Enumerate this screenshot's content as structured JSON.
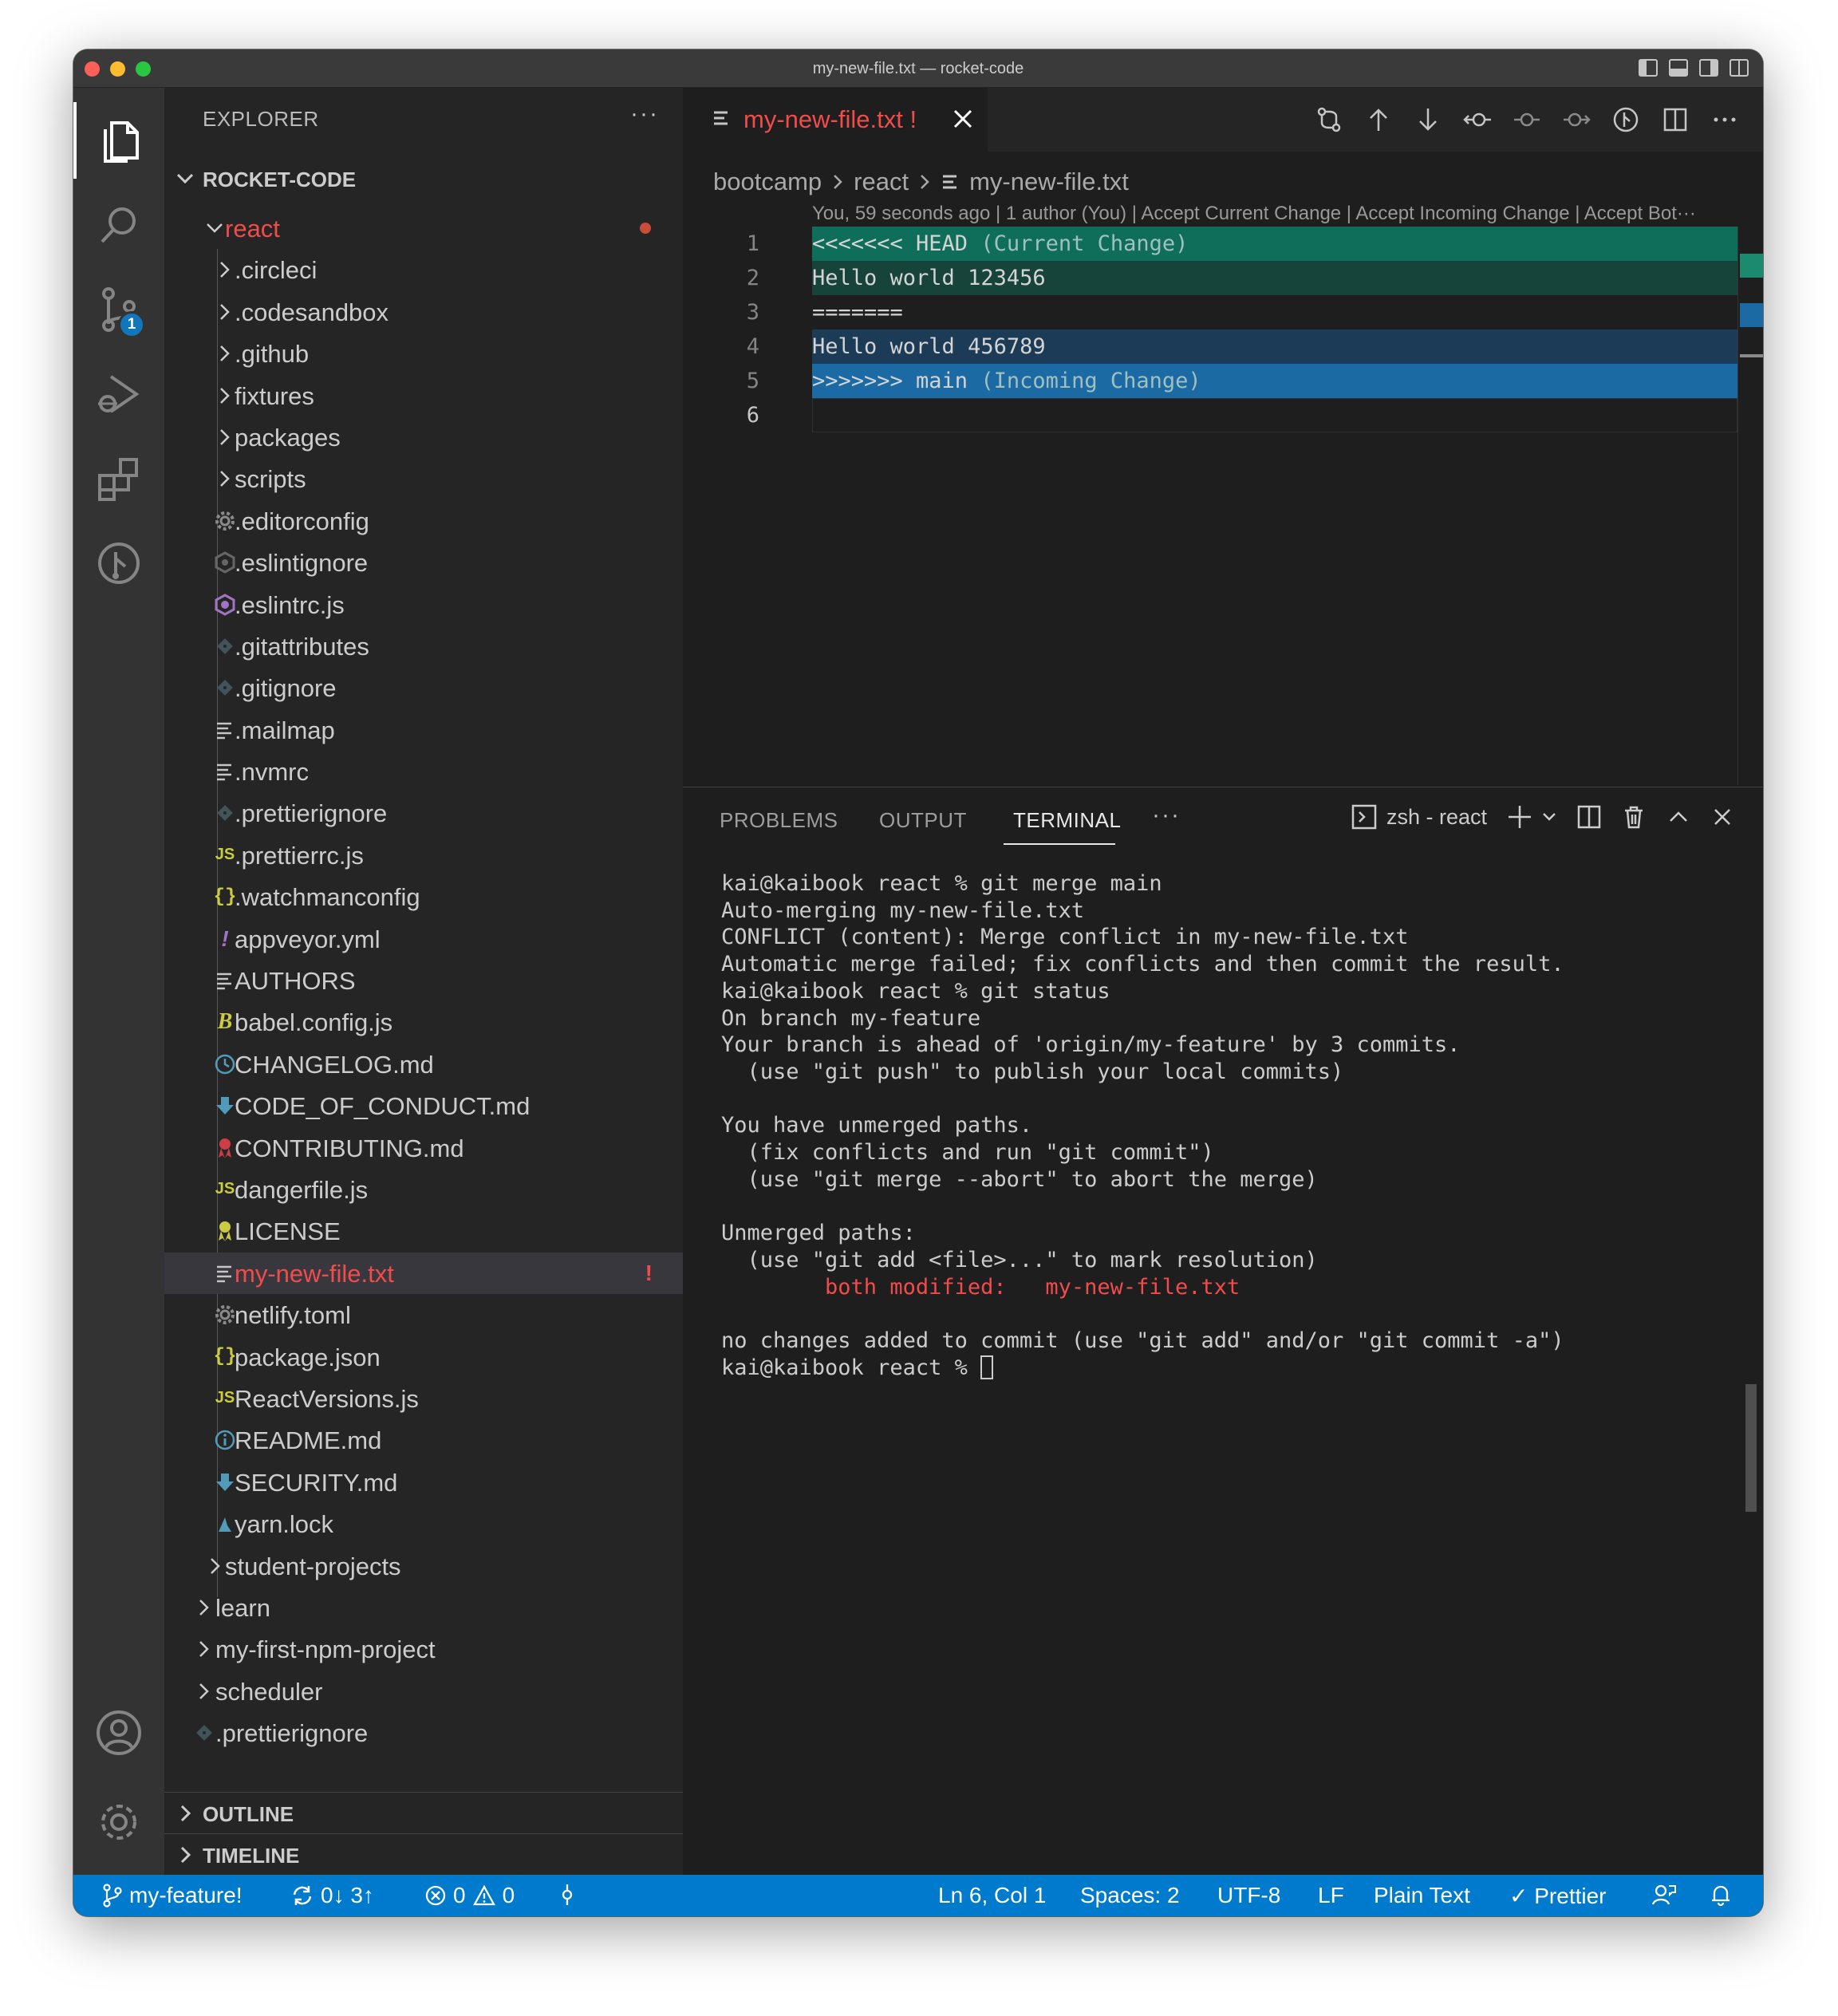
{
  "window": {
    "title": "my-new-file.txt — rocket-code"
  },
  "activity": {
    "scm_badge": "1"
  },
  "explorer": {
    "header": "EXPLORER",
    "more": "···",
    "root": "ROCKET-CODE",
    "outline": "OUTLINE",
    "timeline": "TIMELINE",
    "items": [
      {
        "name": "react",
        "type": "folder-open"
      },
      {
        "name": ".circleci",
        "type": "folder"
      },
      {
        "name": ".codesandbox",
        "type": "folder"
      },
      {
        "name": ".github",
        "type": "folder"
      },
      {
        "name": "fixtures",
        "type": "folder"
      },
      {
        "name": "packages",
        "type": "folder"
      },
      {
        "name": "scripts",
        "type": "folder"
      },
      {
        "name": ".editorconfig",
        "type": "file",
        "icon": "gear-icon"
      },
      {
        "name": ".eslintignore",
        "type": "file",
        "icon": "eslint-gray-icon"
      },
      {
        "name": ".eslintrc.js",
        "type": "file",
        "icon": "eslint-icon"
      },
      {
        "name": ".gitattributes",
        "type": "file",
        "icon": "git-file-icon"
      },
      {
        "name": ".gitignore",
        "type": "file",
        "icon": "git-file-icon"
      },
      {
        "name": ".mailmap",
        "type": "file",
        "icon": "text-file-icon"
      },
      {
        "name": ".nvmrc",
        "type": "file",
        "icon": "text-file-icon"
      },
      {
        "name": ".prettierignore",
        "type": "file",
        "icon": "git-file-icon"
      },
      {
        "name": ".prettierrc.js",
        "type": "file",
        "icon": "js-icon"
      },
      {
        "name": ".watchmanconfig",
        "type": "file",
        "icon": "json-icon"
      },
      {
        "name": "appveyor.yml",
        "type": "file",
        "icon": "yaml-icon"
      },
      {
        "name": "AUTHORS",
        "type": "file",
        "icon": "text-file-icon"
      },
      {
        "name": "babel.config.js",
        "type": "file",
        "icon": "babel-icon"
      },
      {
        "name": "CHANGELOG.md",
        "type": "file",
        "icon": "clock-icon"
      },
      {
        "name": "CODE_OF_CONDUCT.md",
        "type": "file",
        "icon": "markdown-arrow-icon"
      },
      {
        "name": "CONTRIBUTING.md",
        "type": "file",
        "icon": "ribbon-red-icon"
      },
      {
        "name": "dangerfile.js",
        "type": "file",
        "icon": "js-icon"
      },
      {
        "name": "LICENSE",
        "type": "file",
        "icon": "ribbon-yellow-icon"
      },
      {
        "name": "my-new-file.txt",
        "type": "file",
        "icon": "text-file-icon",
        "marker": "!"
      },
      {
        "name": "netlify.toml",
        "type": "file",
        "icon": "gear-icon"
      },
      {
        "name": "package.json",
        "type": "file",
        "icon": "json-icon"
      },
      {
        "name": "ReactVersions.js",
        "type": "file",
        "icon": "js-icon"
      },
      {
        "name": "README.md",
        "type": "file",
        "icon": "info-icon"
      },
      {
        "name": "SECURITY.md",
        "type": "file",
        "icon": "markdown-arrow-icon"
      },
      {
        "name": "yarn.lock",
        "type": "file",
        "icon": "yarn-icon"
      },
      {
        "name": "student-projects",
        "type": "folder"
      },
      {
        "name": "learn",
        "type": "folder"
      },
      {
        "name": "my-first-npm-project",
        "type": "folder"
      },
      {
        "name": "scheduler",
        "type": "folder"
      },
      {
        "name": ".prettierignore",
        "type": "file",
        "icon": "git-file-icon"
      }
    ]
  },
  "editor": {
    "tab": {
      "name": "my-new-file.txt",
      "marker": "!"
    },
    "breadcrumbs": [
      "bootcamp",
      "react",
      "my-new-file.txt"
    ],
    "codelens": "You, 59 seconds ago | 1 author (You) | Accept Current Change | Accept Incoming Change | Accept Bot···",
    "lines": [
      {
        "n": "1",
        "text": "<<<<<<< HEAD",
        "ann": " (Current Change)",
        "bg": "#0e6e5a"
      },
      {
        "n": "2",
        "text": "Hello world 123456",
        "ann": "",
        "bg": "#16433a"
      },
      {
        "n": "3",
        "text": "=======",
        "ann": "",
        "bg": ""
      },
      {
        "n": "4",
        "text": "Hello world 456789",
        "ann": "",
        "bg": "#1c3b56"
      },
      {
        "n": "5",
        "text": ">>>>>>> main",
        "ann": " (Incoming Change)",
        "bg": "#1b6aa3"
      },
      {
        "n": "6",
        "text": "",
        "ann": "",
        "bg": ""
      }
    ]
  },
  "panel": {
    "tabs": [
      "PROBLEMS",
      "OUTPUT",
      "TERMINAL"
    ],
    "more": "···",
    "terminal_name": "zsh - react",
    "terminal": {
      "lines": [
        "kai@kaibook react % git merge main",
        "Auto-merging my-new-file.txt",
        "CONFLICT (content): Merge conflict in my-new-file.txt",
        "Automatic merge failed; fix conflicts and then commit the result.",
        "kai@kaibook react % git status",
        "On branch my-feature",
        "Your branch is ahead of 'origin/my-feature' by 3 commits.",
        "  (use \"git push\" to publish your local commits)",
        "",
        "You have unmerged paths.",
        "  (fix conflicts and run \"git commit\")",
        "  (use \"git merge --abort\" to abort the merge)",
        "",
        "Unmerged paths:",
        "  (use \"git add <file>...\" to mark resolution)"
      ],
      "modified_label": "        both modified:   ",
      "modified_file": "my-new-file.txt",
      "after_lines": [
        "",
        "no changes added to commit (use \"git add\" and/or \"git commit -a\")"
      ],
      "prompt": "kai@kaibook react % "
    }
  },
  "statusbar": {
    "branch": "my-feature!",
    "sync": "0↓ 3↑",
    "errors": "0",
    "warnings": "0",
    "position": "Ln 6, Col 1",
    "spaces": "Spaces: 2",
    "encoding": "UTF-8",
    "eol": "LF",
    "language": "Plain Text",
    "formatter": "✓ Prettier"
  }
}
